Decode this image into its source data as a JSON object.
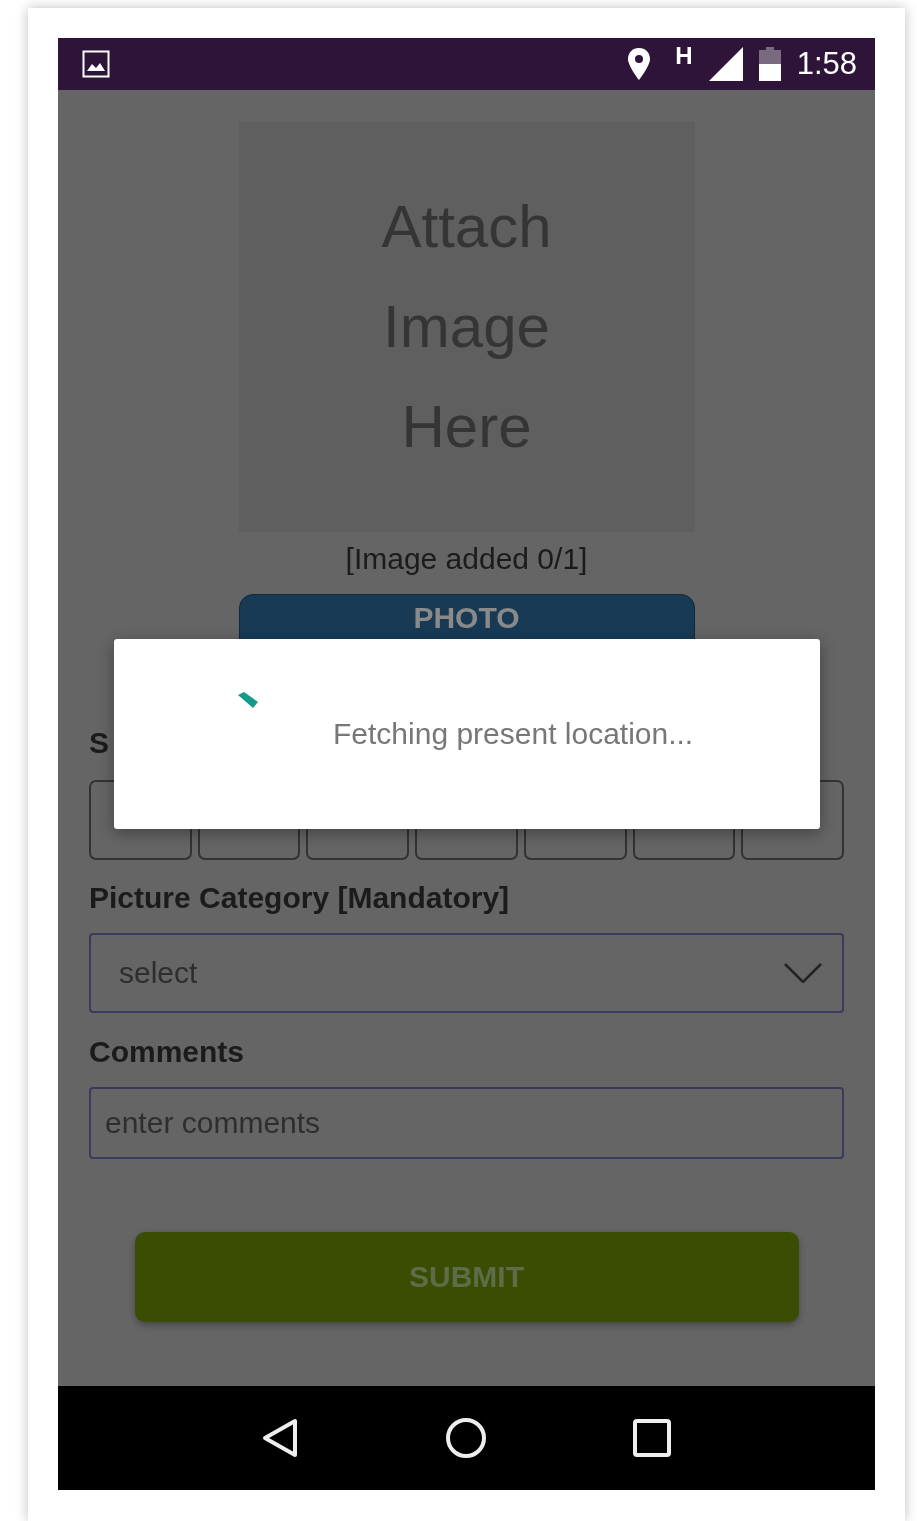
{
  "status_bar": {
    "network_type": "H",
    "time": "1:58"
  },
  "image_placeholder": {
    "lines": [
      "Attach",
      "Image",
      "Here"
    ]
  },
  "image_count": "[Image added 0/1]",
  "photo_button": "PHOTO",
  "segment_field": {
    "label": "S",
    "boxes": [
      {
        "kind": "box"
      },
      {
        "kind": "box"
      },
      {
        "kind": "box"
      },
      {
        "kind": "box"
      },
      {
        "kind": "box"
      },
      {
        "kind": "box"
      },
      {
        "kind": "box"
      }
    ]
  },
  "category_field": {
    "label": "Picture Category [Mandatory]",
    "value": "select"
  },
  "comments_field": {
    "label": "Comments",
    "placeholder": "enter comments"
  },
  "submit_button": "SUBMIT",
  "dialog": {
    "message": "Fetching present location..."
  },
  "nav_bar": {
    "buttons": [
      {
        "kind": "back"
      },
      {
        "kind": "home"
      },
      {
        "kind": "recents"
      }
    ]
  }
}
